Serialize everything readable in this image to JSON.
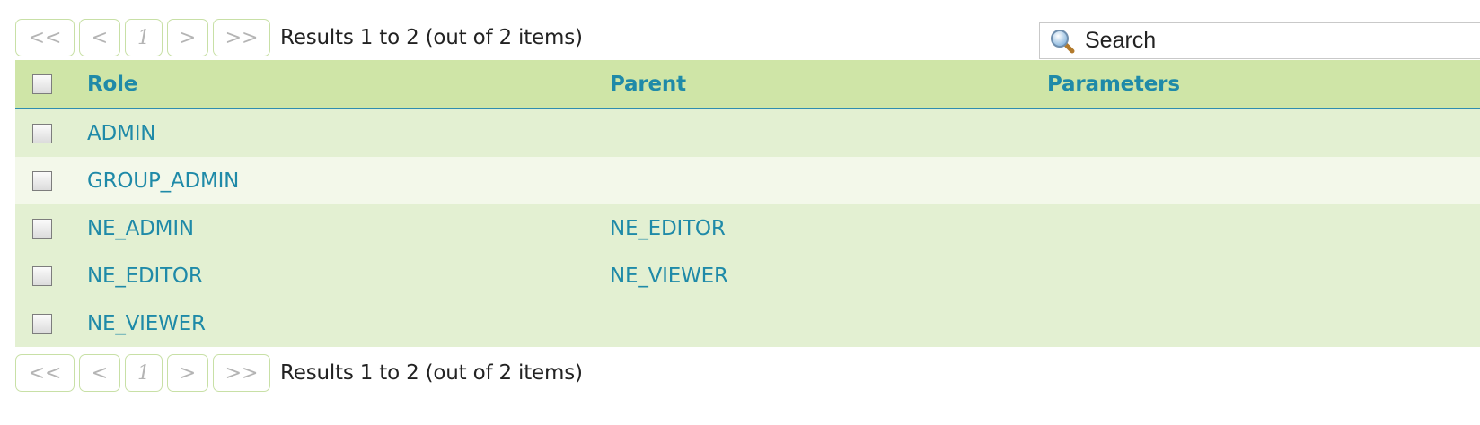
{
  "pager": {
    "first_label": "<<",
    "prev_label": "<",
    "page_label": "1",
    "next_label": ">",
    "last_label": ">>",
    "results_text": "Results 1 to 2 (out of 2 items)"
  },
  "search": {
    "placeholder": "Search",
    "icon": "magnifier-icon"
  },
  "table": {
    "headers": {
      "role": "Role",
      "parent": "Parent",
      "parameters": "Parameters"
    },
    "rows": [
      {
        "role": "ADMIN",
        "parent": "",
        "parameters": ""
      },
      {
        "role": "GROUP_ADMIN",
        "parent": "",
        "parameters": ""
      },
      {
        "role": "NE_ADMIN",
        "parent": "NE_EDITOR",
        "parameters": ""
      },
      {
        "role": "NE_EDITOR",
        "parent": "NE_VIEWER",
        "parameters": ""
      },
      {
        "role": "NE_VIEWER",
        "parent": "",
        "parameters": ""
      }
    ]
  },
  "colors": {
    "header_bg": "#cfe5a7",
    "row_odd_bg": "#e3f0d2",
    "row_even_bg": "#f3f8ea",
    "link_text": "#1f8aa8",
    "header_border": "#2f8db0"
  }
}
